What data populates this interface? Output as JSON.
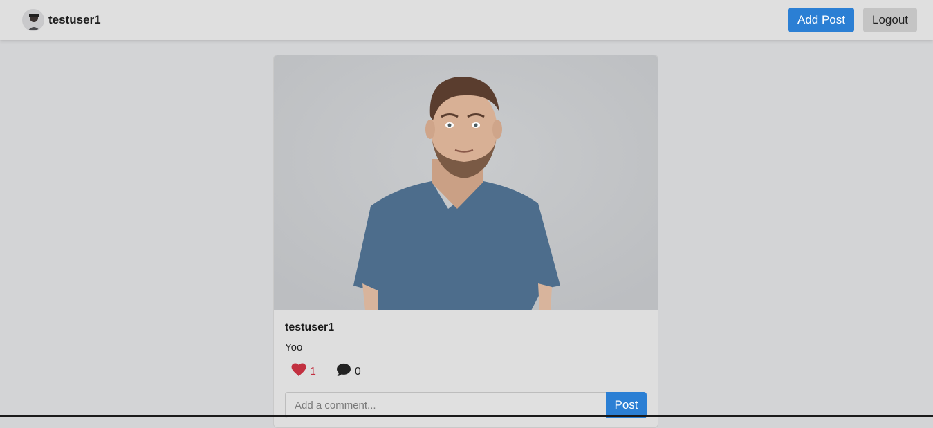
{
  "navbar": {
    "username": "testuser1",
    "add_post_label": "Add Post",
    "logout_label": "Logout"
  },
  "post": {
    "author": "testuser1",
    "caption": "Yoo",
    "likes": "1",
    "comments": "0",
    "comment_placeholder": "Add a comment...",
    "post_button_label": "Post"
  },
  "colors": {
    "primary": "#2b7fd4",
    "like": "#c23040",
    "background": "#d3d4d6"
  },
  "icons": {
    "like": "heart-icon",
    "comment": "speech-bubble-icon"
  }
}
